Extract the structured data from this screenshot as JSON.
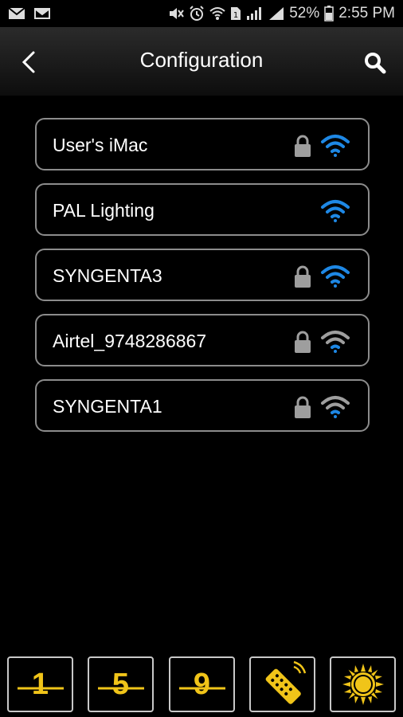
{
  "status_bar": {
    "battery": "52%",
    "time": "2:55 PM"
  },
  "header": {
    "title": "Configuration"
  },
  "networks": [
    {
      "name": "User's iMac",
      "locked": true,
      "signal_color": "#1e88e5"
    },
    {
      "name": "PAL Lighting",
      "locked": false,
      "signal_color": "#1e88e5"
    },
    {
      "name": "SYNGENTA3",
      "locked": true,
      "signal_color": "#1e88e5"
    },
    {
      "name": "Airtel_9748286867",
      "locked": true,
      "signal_color": "#9e9e9e"
    },
    {
      "name": "SYNGENTA1",
      "locked": true,
      "signal_color": "#9e9e9e"
    }
  ],
  "toolbar": {
    "buttons": [
      {
        "label": "1",
        "icon": "preset-1-icon"
      },
      {
        "label": "5",
        "icon": "preset-5-icon"
      },
      {
        "label": "9",
        "icon": "preset-9-icon"
      },
      {
        "label": "",
        "icon": "remote-control-icon"
      },
      {
        "label": "",
        "icon": "sun-icon"
      }
    ],
    "accent": "#f0c419"
  },
  "colors": {
    "background": "#000000",
    "border": "#8c8c8c",
    "wifi_strong": "#1e88e5",
    "wifi_weak": "#9e9e9e"
  }
}
